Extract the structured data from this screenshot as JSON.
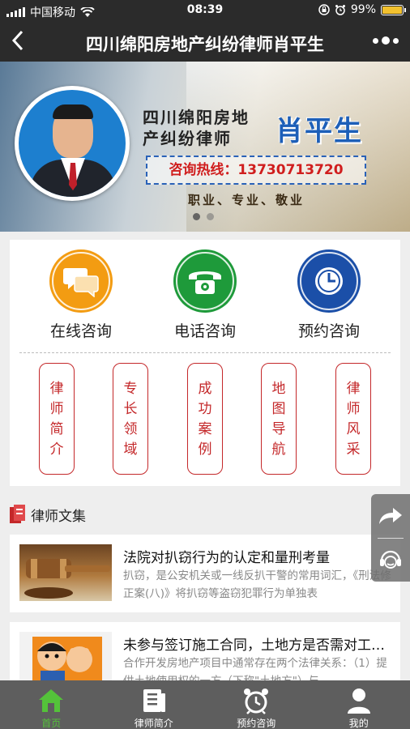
{
  "status_bar": {
    "carrier": "中国移动",
    "time": "08:39",
    "battery": "99%",
    "battery_level": 0.99
  },
  "nav": {
    "back_icon": "chevron-left-icon",
    "title": "四川绵阳房地产纠纷律师肖平生",
    "more_icon": "more-dots-icon"
  },
  "banner": {
    "headline_line1": "四川绵阳房地",
    "headline_line2": "产纠纷律师",
    "name": "肖平生",
    "hotline": "咨询热线：13730713720",
    "slogan": "职业、专业、敬业",
    "slide_count": 2,
    "active_slide": 1
  },
  "services": [
    {
      "label": "在线咨询",
      "icon": "chat-bubbles-icon",
      "color": "#f39c12"
    },
    {
      "label": "电话咨询",
      "icon": "telephone-icon",
      "color": "#1e9a3a"
    },
    {
      "label": "预约咨询",
      "icon": "clock-icon",
      "color": "#1b4fa8"
    }
  ],
  "tags": [
    {
      "chars": [
        "律",
        "师",
        "简",
        "介"
      ]
    },
    {
      "chars": [
        "专",
        "长",
        "领",
        "域"
      ]
    },
    {
      "chars": [
        "成",
        "功",
        "案",
        "例"
      ]
    },
    {
      "chars": [
        "地",
        "图",
        "导",
        "航"
      ]
    },
    {
      "chars": [
        "律",
        "师",
        "风",
        "采"
      ]
    }
  ],
  "articles_section": {
    "title": "律师文集",
    "icon": "book-icon"
  },
  "articles": [
    {
      "title": "法院对扒窃行为的认定和量刑考量",
      "summary": "扒窃，是公安机关或一线反扒干警的常用词汇，《刑法修正案(八)》将扒窃等盗窃犯罪行为单独表",
      "thumb": "gavel-image"
    },
    {
      "title": "未参与签订施工合同，土地方是否需对工程款承担责任",
      "summary": "合作开发房地产项目中通常存在两个法律关系：（1）提供土地使用权的一方（下称\"土地方\"）与",
      "thumb": "cartoon-image"
    }
  ],
  "floating_buttons": [
    {
      "icon": "share-arrow-icon"
    },
    {
      "icon": "customer-service-icon"
    }
  ],
  "colors": {
    "accent_red": "#c4282a",
    "active_tab": "#54c23a",
    "nav_bg": "#2b2b2b",
    "tabbar_bg": "#5e5e5e"
  },
  "tabbar": [
    {
      "label": "首页",
      "icon": "home-icon",
      "active": true
    },
    {
      "label": "律师简介",
      "icon": "document-icon",
      "active": false
    },
    {
      "label": "预约咨询",
      "icon": "alarm-clock-icon",
      "active": false
    },
    {
      "label": "我的",
      "icon": "user-icon",
      "active": false
    }
  ]
}
